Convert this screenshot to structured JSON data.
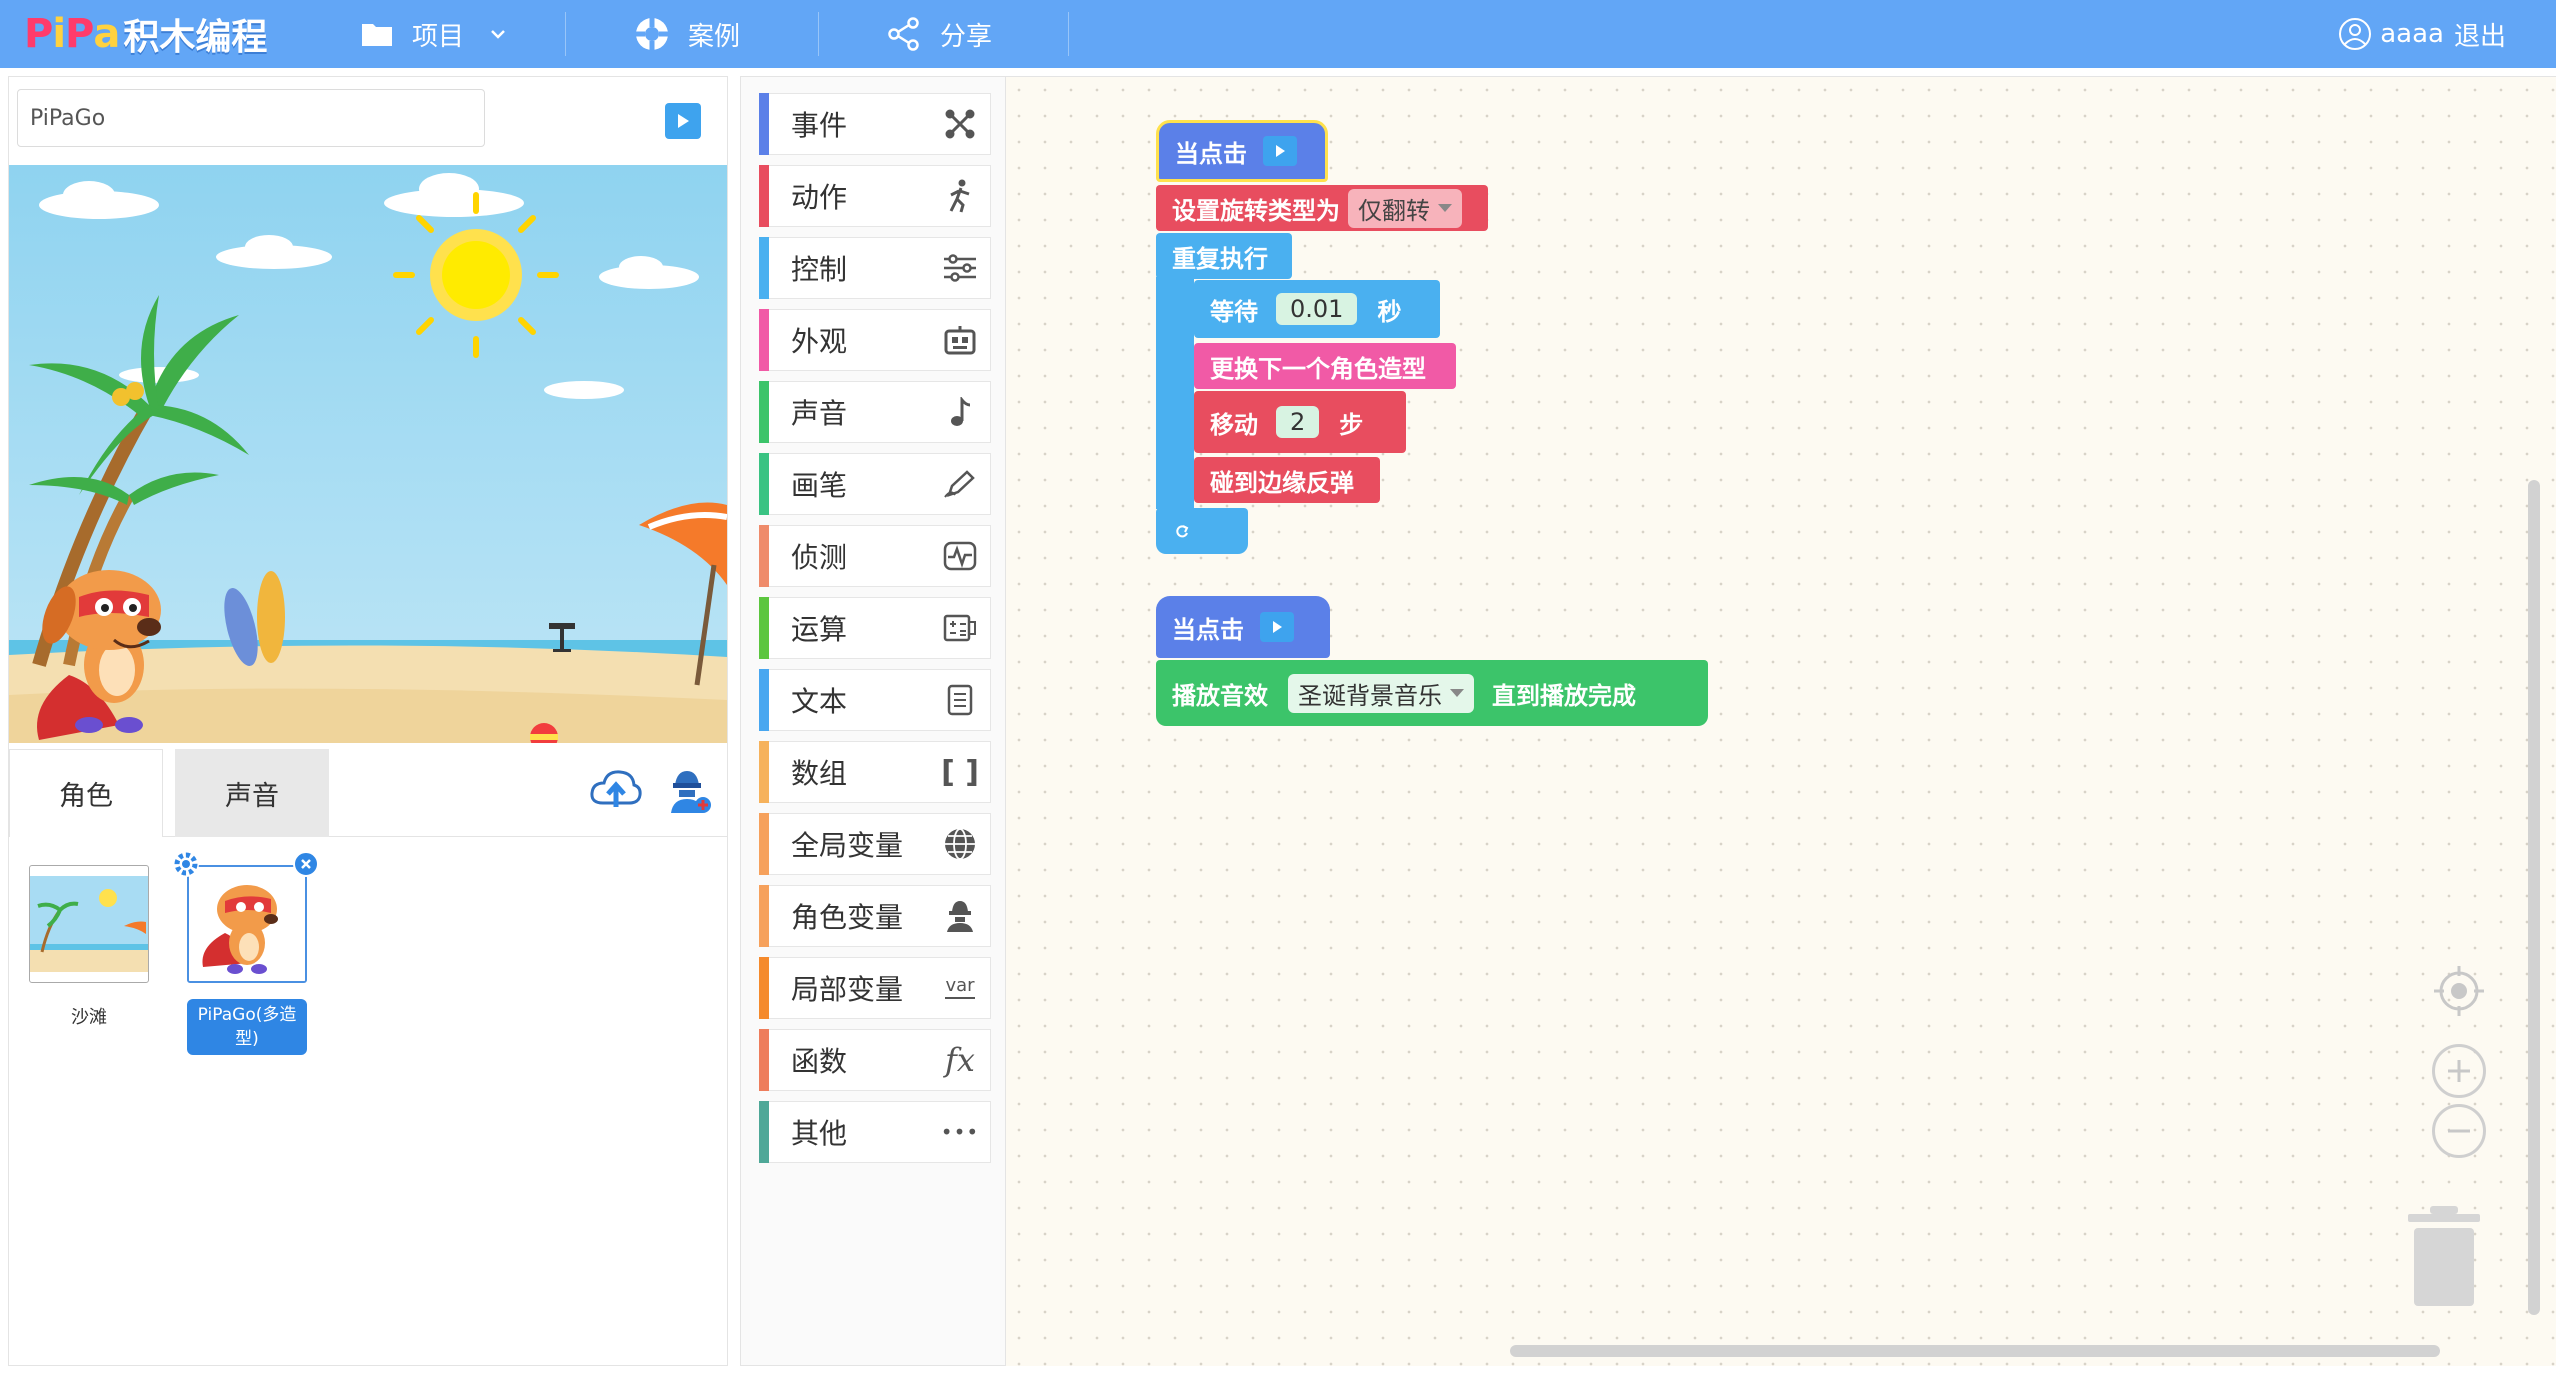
{
  "header": {
    "logo_latin": [
      "P",
      "i",
      "P",
      "a"
    ],
    "logo_text": "积木编程",
    "nav": [
      {
        "label": "项目",
        "icon": "folder-icon",
        "has_dropdown": true
      },
      {
        "label": "案例",
        "icon": "lifebuoy-icon"
      },
      {
        "label": "分享",
        "icon": "share-icon"
      }
    ],
    "user": {
      "name": "aaaa",
      "logout": "退出",
      "icon": "user-icon"
    }
  },
  "stage_panel": {
    "project_name": "PiPaGo",
    "tabs": [
      {
        "label": "角色",
        "active": true
      },
      {
        "label": "声音",
        "active": false
      }
    ],
    "sprites": [
      {
        "name": "沙滩",
        "selected": false
      },
      {
        "name": "PiPaGo(多造型)",
        "selected": true
      }
    ]
  },
  "categories": [
    {
      "label": "事件",
      "color": "#5b80e8",
      "icon": "network-icon"
    },
    {
      "label": "动作",
      "color": "#e84d5f",
      "icon": "run-icon"
    },
    {
      "label": "控制",
      "color": "#4ab0f0",
      "icon": "sliders-icon"
    },
    {
      "label": "外观",
      "color": "#f15aa6",
      "icon": "robot-icon"
    },
    {
      "label": "声音",
      "color": "#3cc46a",
      "icon": "music-note-icon"
    },
    {
      "label": "画笔",
      "color": "#3ac383",
      "icon": "pencil-icon"
    },
    {
      "label": "侦测",
      "color": "#ef8b6b",
      "icon": "pulse-icon"
    },
    {
      "label": "运算",
      "color": "#5cc63f",
      "icon": "calculator-icon"
    },
    {
      "label": "文本",
      "color": "#48a7f0",
      "icon": "document-icon"
    },
    {
      "label": "数组",
      "color": "#f6b25c",
      "icon": "brackets-icon"
    },
    {
      "label": "全局变量",
      "color": "#f6a15c",
      "icon": "globe-icon"
    },
    {
      "label": "角色变量",
      "color": "#f6a15c",
      "icon": "agent-icon"
    },
    {
      "label": "局部变量",
      "color": "#f58a2c",
      "icon": "var-icon"
    },
    {
      "label": "函数",
      "color": "#ee7d5c",
      "icon": "fx-icon"
    },
    {
      "label": "其他",
      "color": "#4fa898",
      "icon": "more-icon"
    }
  ],
  "icons": {
    "var_label": "var",
    "fx_label": "fx",
    "brackets_label": "[ ]",
    "more_label": "•••"
  },
  "script1": {
    "hat": "当点击",
    "rotation": {
      "label": "设置旋转类型为",
      "value": "仅翻转"
    },
    "forever": "重复执行",
    "wait": {
      "label": "等待",
      "value": "0.01",
      "unit": "秒"
    },
    "next_costume": "更换下一个角色造型",
    "move": {
      "label": "移动",
      "value": "2",
      "unit": "步"
    },
    "bounce": "碰到边缘反弹"
  },
  "script2": {
    "hat": "当点击",
    "play": {
      "label": "播放音效",
      "value": "圣诞背景音乐",
      "suffix": "直到播放完成"
    }
  }
}
